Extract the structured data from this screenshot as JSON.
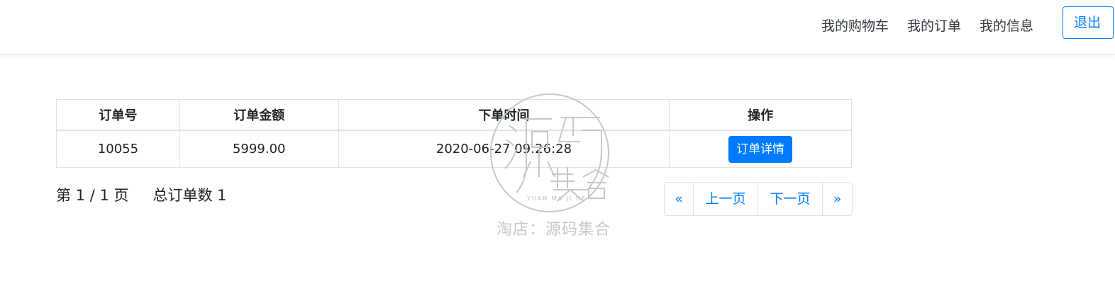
{
  "navbar": {
    "links": [
      "我的购物车",
      "我的订单",
      "我的信息"
    ],
    "logout_label": "退出",
    "accent_color": "#007bff"
  },
  "orders_table": {
    "headers": [
      "订单号",
      "订单金额",
      "下单时间",
      "操作"
    ],
    "rows": [
      {
        "order_no": "10055",
        "amount": "5999.00",
        "time": "2020-06-27 09:26:28",
        "action_label": "订单详情"
      }
    ]
  },
  "pagination": {
    "page_label": "第 1 / 1 页",
    "total_label": "总订单数 1",
    "first": "«",
    "prev": "上一页",
    "next": "下一页",
    "last": "»"
  },
  "watermark": {
    "main_text": "淘店：源码集合",
    "sub_text": "YUAN MA JI HE",
    "logo_text": "源码集合"
  }
}
